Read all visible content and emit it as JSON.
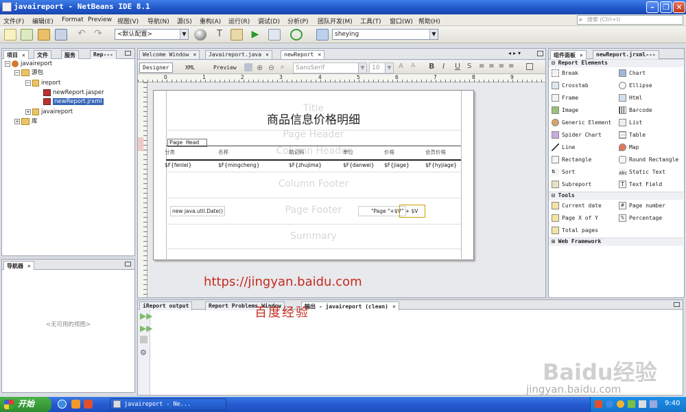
{
  "window": {
    "title": "javaireport - NetBeans IDE 8.1"
  },
  "menu": {
    "items": [
      "文件(F)",
      "编辑(E)",
      "Format",
      "Preview",
      "视图(V)",
      "导航(N)",
      "源(S)",
      "重构(A)",
      "运行(R)",
      "调试(D)",
      "分析(P)",
      "团队开发(M)",
      "工具(T)",
      "窗口(W)",
      "帮助(H)"
    ],
    "search_placeholder": "搜索 (Ctrl+I)"
  },
  "toolbar": {
    "config_value": "<默认配置>",
    "project_value": "sheying"
  },
  "left_panel": {
    "tabs": [
      "项目",
      "文件",
      "服务",
      "Rep---"
    ],
    "tree": {
      "root": "javaireport",
      "src": "源包",
      "pkg": "ireport",
      "file1": "newReport.jasper",
      "file2": "newReport.jrxml",
      "pkg2": "javaireport",
      "lib": "库"
    }
  },
  "navigator": {
    "title": "导航器",
    "empty": "<无可用的视图>"
  },
  "editor": {
    "tabs": [
      "Welcome Window",
      "Javaireport.java",
      "newReport"
    ],
    "modes": [
      "Designer",
      "XML",
      "Preview"
    ],
    "font_value": "SansSerif",
    "size_value": "10",
    "ruler": [
      "0",
      "1",
      "2",
      "3",
      "4",
      "5",
      "6",
      "7",
      "8",
      "9"
    ]
  },
  "report": {
    "title": "商品信息价格明细",
    "title_band_wm": "Title",
    "page_header_wm": "Page Header",
    "page_header_label": "Page Head",
    "column_header_wm": "Column Header",
    "headers": [
      "分类",
      "名称",
      "助记码",
      "单位",
      "价格",
      "会员价格"
    ],
    "fields": [
      "$F{fenlei}",
      "$F{mingcheng}",
      "$F{zhujima}",
      "$F{danwei}",
      "$F{jiage}",
      "$F{hyjiage}"
    ],
    "column_footer_wm": "Column Footer",
    "page_footer_wm": "Page Footer",
    "footer_date": "new java.util.Date()",
    "footer_page": "\"Page \"+$V",
    "footer_page2": "\" + $V",
    "summary_wm": "Summary"
  },
  "watermark": {
    "url": "https://jingyan.baidu.com",
    "brand": "百度经验",
    "baidu": "Baidu经验",
    "site": "jingyan.baidu.com"
  },
  "output": {
    "tabs": [
      "iReport output",
      "Report Problems Window",
      "输出 - javaireport (clean)"
    ]
  },
  "palette": {
    "tabs": [
      "组件面板",
      "newReport.jrxml---"
    ],
    "sec1": "Report Elements",
    "elements_left": [
      "Break",
      "Crosstab",
      "Frame",
      "Image",
      "Generic Element",
      "Spider Chart",
      "Line",
      "Rectangle",
      "Sort",
      "Subreport"
    ],
    "elements_right": [
      "Chart",
      "Ellipse",
      "Html",
      "Barcode",
      "List",
      "Table",
      "Map",
      "Round Rectangle",
      "Static Text",
      "Text Field"
    ],
    "sec2": "Tools",
    "tools_left": [
      "Current date",
      "Page X of Y",
      "Total pages"
    ],
    "tools_right": [
      "Page number",
      "Percentage"
    ],
    "sec3": "Web Framework"
  },
  "taskbar": {
    "start": "开始",
    "task": "javaireport - Ne...",
    "time": "9:40"
  }
}
